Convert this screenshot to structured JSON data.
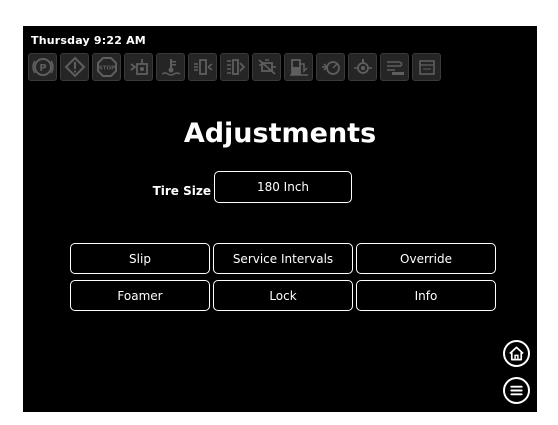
{
  "status": {
    "datetime": "Thursday 9:22 AM"
  },
  "indicators": [
    {
      "name": "parking-brake-icon",
      "glyph": "P"
    },
    {
      "name": "warning-icon",
      "glyph": "!"
    },
    {
      "name": "stop-icon",
      "glyph": "STOP"
    },
    {
      "name": "engine-fluid-icon",
      "glyph": ""
    },
    {
      "name": "coolant-temperature-icon",
      "glyph": ""
    },
    {
      "name": "hydraulic-filter-icon",
      "glyph": ""
    },
    {
      "name": "transmission-filter-icon",
      "glyph": ""
    },
    {
      "name": "engine-fault-icon",
      "glyph": ""
    },
    {
      "name": "fuel-level-icon",
      "glyph": ""
    },
    {
      "name": "oil-pressure-icon",
      "glyph": ""
    },
    {
      "name": "oil-temperature-icon",
      "glyph": ""
    },
    {
      "name": "air-filter-icon",
      "glyph": ""
    },
    {
      "name": "service-icon",
      "glyph": ""
    }
  ],
  "page": {
    "title": "Adjustments"
  },
  "tire_size": {
    "label": "Tire Size",
    "value": "180 Inch"
  },
  "buttons": {
    "slip": "Slip",
    "service_intervals": "Service Intervals",
    "override": "Override",
    "foamer": "Foamer",
    "lock": "Lock",
    "info": "Info"
  },
  "colors": {
    "screen_background": "#000000",
    "text": "#ffffff",
    "indicator_inactive": "#5e5e5e"
  }
}
